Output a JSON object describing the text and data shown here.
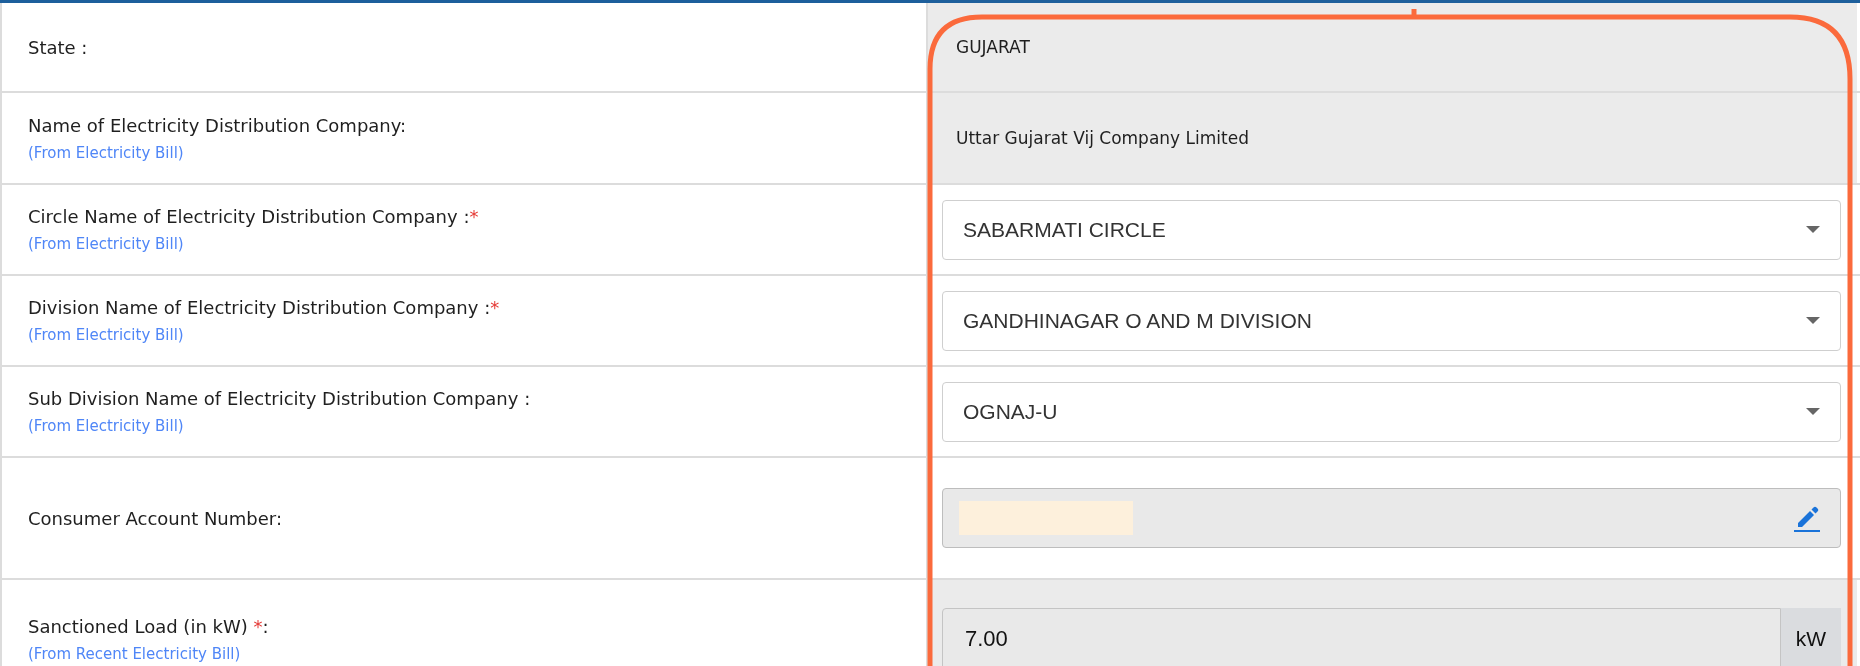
{
  "rows": [
    {
      "label": "State :",
      "kind": "text",
      "value": "GUJARAT"
    },
    {
      "label": "Name of Electricity Distribution Company:",
      "hint": "(From Electricity Bill)",
      "kind": "text",
      "value": "Uttar Gujarat Vij Company Limited"
    },
    {
      "label": "Circle Name of Electricity Distribution Company :",
      "required_mark": "*",
      "hint": "(From Electricity Bill)",
      "kind": "select",
      "value": "SABARMATI CIRCLE"
    },
    {
      "label": "Division Name of Electricity Distribution Company :",
      "required_mark": "*",
      "hint": "(From Electricity Bill)",
      "kind": "select",
      "value": "GANDHINAGAR O AND M DIVISION"
    },
    {
      "label": "Sub Division Name of Electricity Distribution Company :",
      "hint": "(From Electricity Bill)",
      "kind": "select",
      "value": "OGNAJ-U"
    },
    {
      "label": "Consumer Account Number:",
      "kind": "masked"
    },
    {
      "label": "Sanctioned Load (in kW) ",
      "required_mark": "*",
      "label_after": ":",
      "hint": "(From Recent Electricity Bill)",
      "kind": "unit",
      "value": "7.00",
      "unit": "kW"
    }
  ]
}
